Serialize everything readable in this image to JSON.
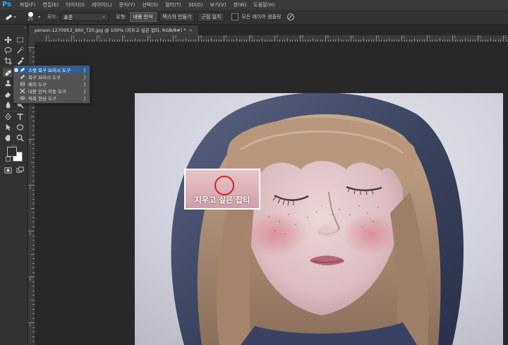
{
  "app": {
    "logo": "Ps",
    "menu": [
      "파일(F)",
      "편집(E)",
      "이미지(I)",
      "레이어(L)",
      "문자(Y)",
      "선택(S)",
      "필터(T)",
      "3D(D)",
      "보기(V)",
      "창(W)",
      "도움말(H)"
    ]
  },
  "options": {
    "brush_size": "25",
    "mode_label": "모드:",
    "mode_value": "표준",
    "type_label": "유형:",
    "type_buttons": [
      "내용 인식",
      "텍스처 만들기",
      "근접 일치"
    ],
    "sample_all_layers": "모든 레이어 샘플링"
  },
  "document": {
    "tab_title": "person-1270953_960_720.jpg @ 100% (지우고 싶은 잡티, RGB/8#) *",
    "tab_close": "×"
  },
  "rulers": {
    "top": [
      "2",
      "1",
      "0",
      "1",
      "2",
      "3",
      "4",
      "5",
      "6",
      "7",
      "8",
      "9",
      "1",
      "1",
      "1",
      "1",
      "1",
      "1",
      "1"
    ],
    "left": [
      "1",
      "0",
      "1",
      "2",
      "3",
      "4",
      "5"
    ]
  },
  "flyout": {
    "items": [
      {
        "label": "스팟 복구 브러시 도구",
        "key": "J",
        "icon": "spot-healing-brush-icon",
        "highlighted": true
      },
      {
        "label": "복구 브러시 도구",
        "key": "J",
        "icon": "healing-brush-icon",
        "highlighted": false
      },
      {
        "label": "패치 도구",
        "key": "J",
        "icon": "patch-icon",
        "highlighted": false
      },
      {
        "label": "내용 인식 이동 도구",
        "key": "J",
        "icon": "content-aware-move-icon",
        "highlighted": false
      },
      {
        "label": "적목 현상 도구",
        "key": "J",
        "icon": "red-eye-icon",
        "highlighted": false
      }
    ]
  },
  "annotation": {
    "label": "지우고 싶은 잡티",
    "circle_color": "#d81e2c",
    "border_color": "#ffffff"
  },
  "colors": {
    "accent": "#31a8ff",
    "flyout_highlight": "#2f5f93"
  }
}
